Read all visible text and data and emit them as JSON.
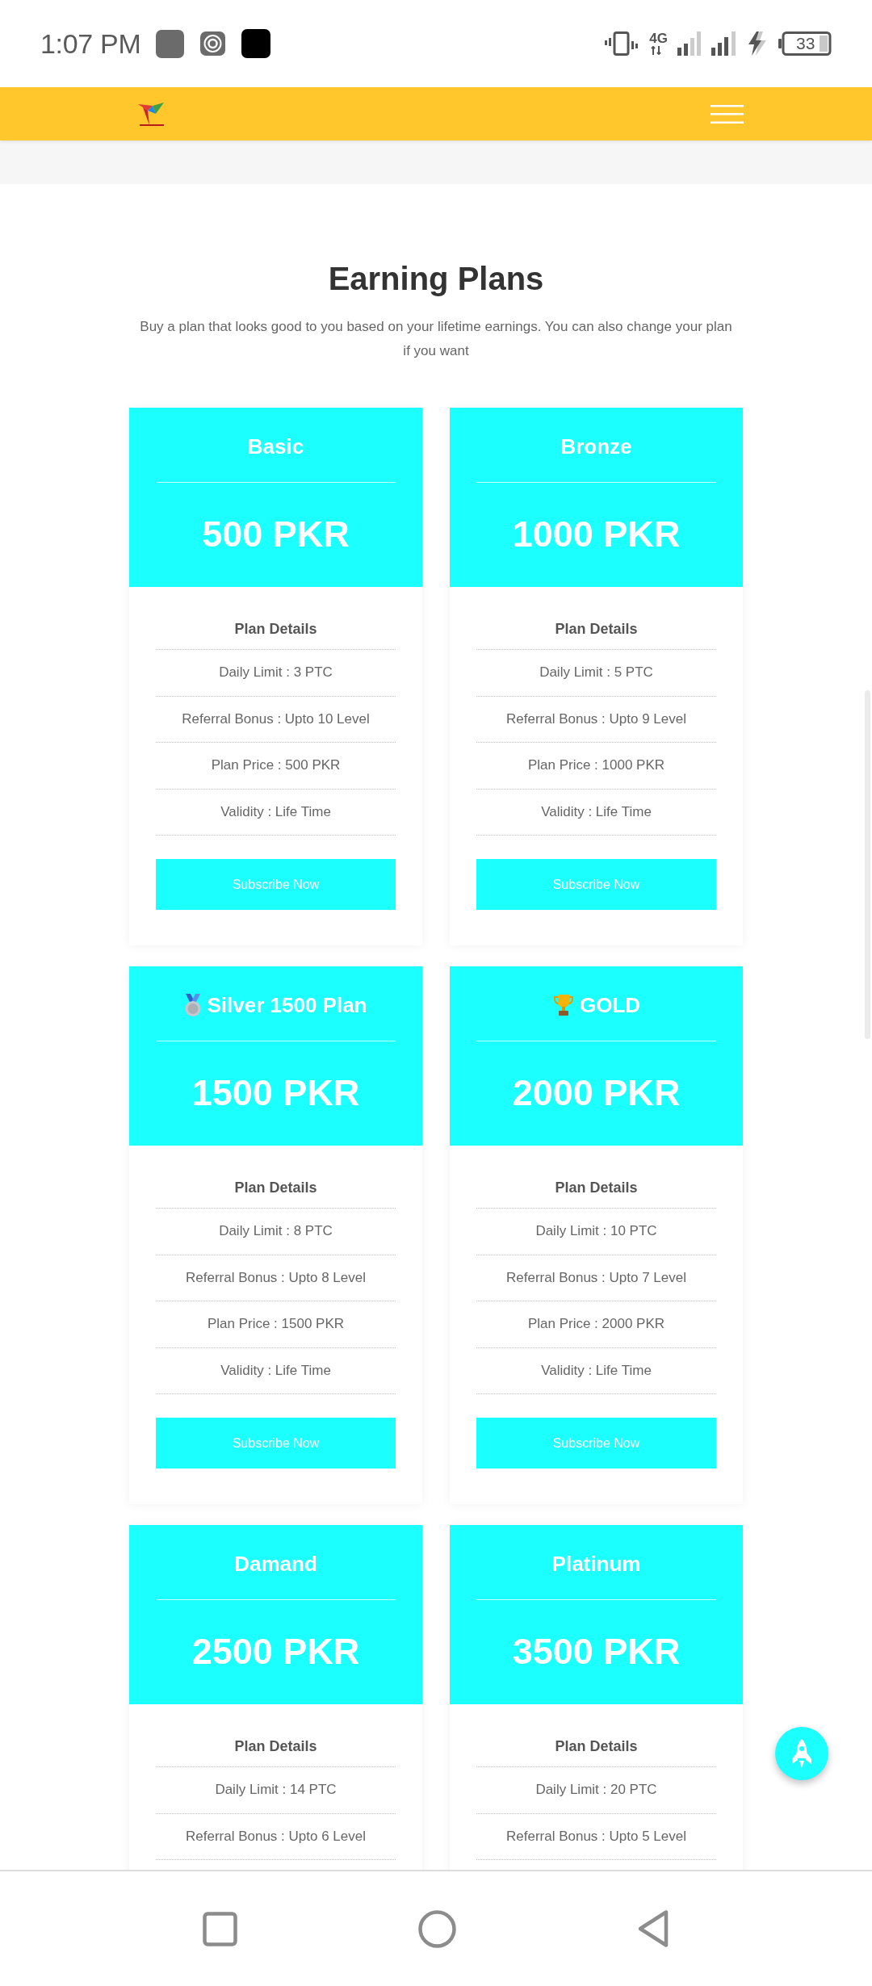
{
  "status_bar": {
    "time": "1:07 PM",
    "network_type": "4G",
    "battery": "33"
  },
  "section": {
    "title": "Earning Plans",
    "subtitle": "Buy a plan that looks good to you based on your lifetime earnings. You can also change your plan if you want"
  },
  "plans": [
    {
      "kind": "plain",
      "name": "Basic",
      "price": "500 PKR",
      "details_title": "Plan Details",
      "details": [
        "Daily Limit : 3 PTC",
        "Referral Bonus : Upto 10 Level",
        "Plan Price : 500 PKR",
        "Validity : Life Time"
      ],
      "button": "Subscribe Now"
    },
    {
      "kind": "plain",
      "name": "Bronze",
      "price": "1000 PKR",
      "details_title": "Plan Details",
      "details": [
        "Daily Limit : 5 PTC",
        "Referral Bonus : Upto 9 Level",
        "Plan Price : 1000 PKR",
        "Validity : Life Time"
      ],
      "button": "Subscribe Now"
    },
    {
      "kind": "medal",
      "name": "Silver 1500 Plan",
      "price": "1500 PKR",
      "details_title": "Plan Details",
      "details": [
        "Daily Limit : 8 PTC",
        "Referral Bonus : Upto 8 Level",
        "Plan Price : 1500 PKR",
        "Validity : Life Time"
      ],
      "button": "Subscribe Now"
    },
    {
      "kind": "trophy",
      "name": "GOLD",
      "price": "2000 PKR",
      "details_title": "Plan Details",
      "details": [
        "Daily Limit : 10 PTC",
        "Referral Bonus : Upto 7 Level",
        "Plan Price : 2000 PKR",
        "Validity : Life Time"
      ],
      "button": "Subscribe Now"
    },
    {
      "kind": "plain",
      "name": "Damand",
      "price": "2500 PKR",
      "details_title": "Plan Details",
      "details": [
        "Daily Limit : 14 PTC",
        "Referral Bonus : Upto 6 Level"
      ]
    },
    {
      "kind": "plain",
      "name": "Platinum",
      "price": "3500 PKR",
      "details_title": "Plan Details",
      "details": [
        "Daily Limit : 20 PTC",
        "Referral Bonus : Upto 5 Level"
      ]
    }
  ]
}
